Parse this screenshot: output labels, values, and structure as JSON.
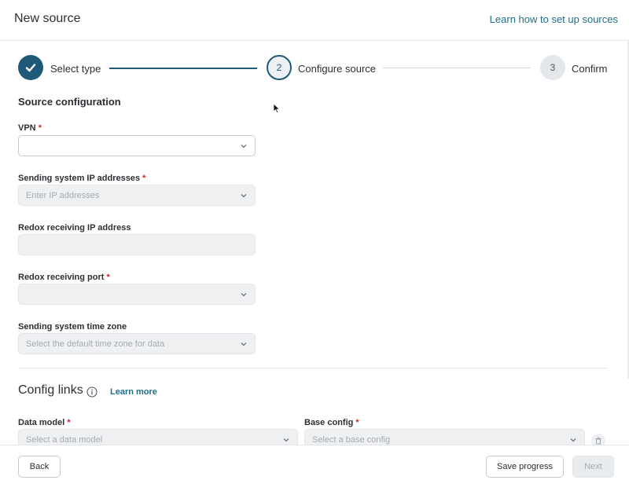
{
  "header": {
    "title": "New source",
    "help_link": "Learn how to set up sources"
  },
  "stepper": {
    "steps": [
      {
        "number": "1",
        "label": "Select type",
        "state": "completed"
      },
      {
        "number": "2",
        "label": "Configure source",
        "state": "current"
      },
      {
        "number": "3",
        "label": "Confirm",
        "state": "upcoming"
      }
    ]
  },
  "source_config": {
    "heading": "Source configuration",
    "vpn": {
      "label": "VPN",
      "required_mark": "*",
      "value": ""
    },
    "sending_ips": {
      "label": "Sending system IP addresses",
      "required_mark": "*",
      "placeholder": "Enter IP addresses"
    },
    "redox_ip": {
      "label": "Redox receiving IP address",
      "value": ""
    },
    "redox_port": {
      "label": "Redox receiving port",
      "required_mark": "*",
      "value": ""
    },
    "time_zone": {
      "label": "Sending system time zone",
      "placeholder": "Select the default time zone for data"
    }
  },
  "config_links": {
    "title": "Config links",
    "learn_more": "Learn more",
    "data_model": {
      "label": "Data model",
      "required_mark": "*",
      "placeholder": "Select a data model"
    },
    "base_config": {
      "label": "Base config",
      "required_mark": "*",
      "placeholder": "Select a base config"
    }
  },
  "footer": {
    "back": "Back",
    "save": "Save progress",
    "next": "Next"
  },
  "colors": {
    "primary": "#1e5a78",
    "link": "#1f6f86",
    "required": "#d1242f"
  },
  "icons": [
    "check-icon",
    "chevron-down-icon",
    "info-icon",
    "trash-icon",
    "cursor-icon"
  ]
}
